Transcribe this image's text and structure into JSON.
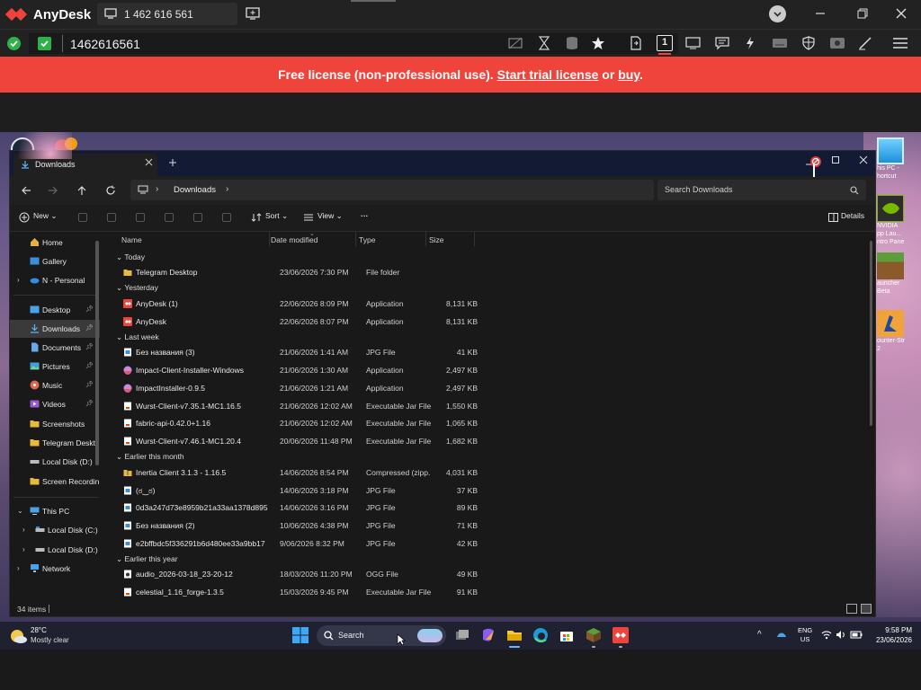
{
  "anydesk": {
    "app_name": "AnyDesk",
    "tab_address": "1 462 616 561",
    "address_value": "1462616561",
    "banner": {
      "text": "Free license (non-professional use).",
      "link1": "Start trial license",
      "middle": "or",
      "link2": "buy",
      "end": "."
    },
    "colors": {
      "banner": "#ef443b",
      "logo": "#ef443b",
      "status_ok": "#2fb14a"
    }
  },
  "explorer": {
    "tab_title": "Downloads",
    "breadcrumb": [
      "Downloads"
    ],
    "search_placeholder": "Search Downloads",
    "toolbar": {
      "new": "New",
      "sort": "Sort",
      "view": "View",
      "more": "···",
      "details": "Details"
    },
    "columns": [
      "Name",
      "Date modified",
      "Type",
      "Size"
    ],
    "sidebar": {
      "home": "Home",
      "gallery": "Gallery",
      "onedrive": "N - Personal",
      "desktop": "Desktop",
      "downloads": "Downloads",
      "documents": "Documents",
      "pictures": "Pictures",
      "music": "Music",
      "videos": "Videos",
      "screenshots": "Screenshots",
      "telegram": "Telegram Deskt",
      "local_d": "Local Disk (D:)",
      "screen_rec": "Screen Recordin",
      "this_pc": "This PC",
      "pc_local_c": "Local Disk (C:)",
      "pc_local_d": "Local Disk (D:)",
      "network": "Network"
    },
    "groups": {
      "today": "Today",
      "yesterday": "Yesterday",
      "last_week": "Last week",
      "earlier_month": "Earlier this month",
      "earlier_year": "Earlier this year"
    },
    "files": [
      {
        "name": "Telegram Desktop",
        "date": "23/06/2026 7:30 PM",
        "type": "File folder",
        "size": "",
        "icon": "folder-icon"
      },
      {
        "name": "AnyDesk (1)",
        "date": "22/06/2026 8:09 PM",
        "type": "Application",
        "size": "8,131 KB",
        "icon": "anydesk-icon"
      },
      {
        "name": "AnyDesk",
        "date": "22/06/2026 8:07 PM",
        "type": "Application",
        "size": "8,131 KB",
        "icon": "anydesk-icon"
      },
      {
        "name": "Без названия (3)",
        "date": "21/06/2026 1:41 AM",
        "type": "JPG File",
        "size": "41 KB",
        "icon": "image-file-icon"
      },
      {
        "name": "Impact-Client-Installer-Windows",
        "date": "21/06/2026 1:30 AM",
        "type": "Application",
        "size": "2,497 KB",
        "icon": "installer-icon"
      },
      {
        "name": "ImpactInstaller-0.9.5",
        "date": "21/06/2026 1:21 AM",
        "type": "Application",
        "size": "2,497 KB",
        "icon": "installer-icon"
      },
      {
        "name": "Wurst-Client-v7.35.1-MC1.16.5",
        "date": "21/06/2026 12:02 AM",
        "type": "Executable Jar File",
        "size": "1,550 KB",
        "icon": "jar-icon"
      },
      {
        "name": "fabric-api-0.42.0+1.16",
        "date": "21/06/2026 12:02 AM",
        "type": "Executable Jar File",
        "size": "1,065 KB",
        "icon": "jar-icon"
      },
      {
        "name": "Wurst-Client-v7.46.1-MC1.20.4",
        "date": "20/06/2026 11:48 PM",
        "type": "Executable Jar File",
        "size": "1,682 KB",
        "icon": "jar-icon"
      },
      {
        "name": "Inertia Client 3.1.3 - 1.16.5",
        "date": "14/06/2026 8:54 PM",
        "type": "Compressed (zipp...",
        "size": "4,031 KB",
        "icon": "zip-folder-icon"
      },
      {
        "name": "(ಠ‿ಠ)",
        "date": "14/06/2026 3:18 PM",
        "type": "JPG File",
        "size": "37 KB",
        "icon": "image-file-icon"
      },
      {
        "name": "0d3a247d73e8959b21a33aa1378d895",
        "date": "14/06/2026 3:16 PM",
        "type": "JPG File",
        "size": "89 KB",
        "icon": "image-file-icon"
      },
      {
        "name": "Без названия (2)",
        "date": "10/06/2026 4:38 PM",
        "type": "JPG File",
        "size": "71 KB",
        "icon": "image-file-icon"
      },
      {
        "name": "e2bffbdc5f336291b6d480ee33a9bb17",
        "date": "9/06/2026 8:32 PM",
        "type": "JPG File",
        "size": "42 KB",
        "icon": "image-file-icon"
      },
      {
        "name": "audio_2026-03-18_23-20-12",
        "date": "18/03/2026 11:20 PM",
        "type": "OGG File",
        "size": "49 KB",
        "icon": "audio-file-icon"
      },
      {
        "name": "celestial_1.16_forge-1.3.5",
        "date": "15/03/2026 9:45 PM",
        "type": "Executable Jar File",
        "size": "91 KB",
        "icon": "jar-icon"
      }
    ],
    "status": "34 items"
  },
  "desktop": {
    "icons": [
      "his PC -\nhortcut",
      "NVIDIA\npp Lau...\nntro Pane",
      "auncher\nBeta",
      "ounter-Str\n2"
    ]
  },
  "taskbar": {
    "weather_temp": "28°C",
    "weather_desc": "Mostly clear",
    "search": "Search",
    "lang1": "ENG",
    "lang2": "US",
    "time": "9:58 PM",
    "date": "23/06/2026"
  }
}
